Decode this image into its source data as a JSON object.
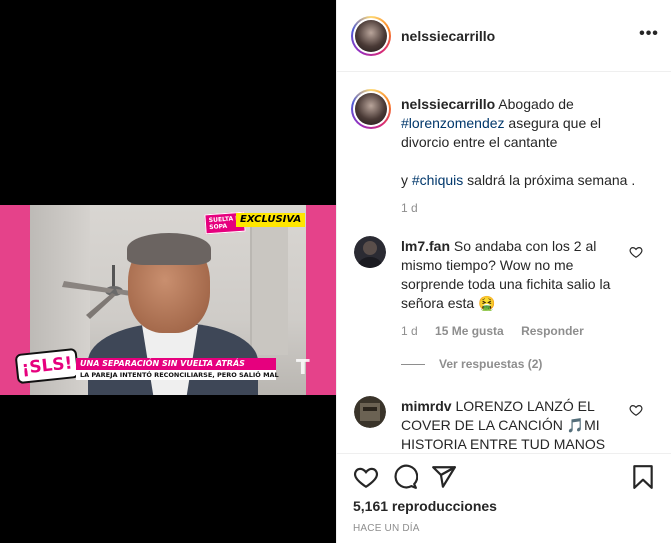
{
  "header": {
    "username": "nelssiecarrillo",
    "more_label": "•••"
  },
  "video": {
    "badge_suelta": "SUELTA LA SOPA",
    "badge_exclusiva": "EXCLUSIVA",
    "logo": "¡SLS!",
    "headline": "UNA SEPARACIÓN SIN VUELTA ATRÁS",
    "subheadline": "LA PAREJA INTENTÓ RECONCILIARSE, PERO SALIÓ MAL",
    "network_logo": "T"
  },
  "caption": {
    "username": "nelssiecarrillo",
    "text_1": "Abogado de ",
    "hashtag_1": "#lorenzomendez",
    "text_2": " asegura que el divorcio entre el cantante",
    "text_3": "y ",
    "hashtag_2": "#chiquis",
    "text_4": " saldrá la próxima semana .",
    "age": "1 d"
  },
  "comments": [
    {
      "username": "lm7.fan",
      "text": "So andaba con los 2 al mismo tiempo? Wow no me sorprende toda una fichita salio la señora esta 🤮",
      "age": "1 d",
      "likes": "15 Me gusta",
      "reply_label": "Responder",
      "view_replies": "Ver respuestas (2)"
    },
    {
      "username": "mimrdv",
      "text": "LORENZO LANZÓ EL COVER DE LA CANCIÓN 🎵MI HISTORIA ENTRE TUD MANOS"
    }
  ],
  "footer": {
    "views": "5,161 reproducciones",
    "posted": "HACE UN DÍA"
  },
  "icons": {
    "like": "heart-icon",
    "comment": "comment-icon",
    "share": "share-icon",
    "save": "bookmark-icon"
  }
}
